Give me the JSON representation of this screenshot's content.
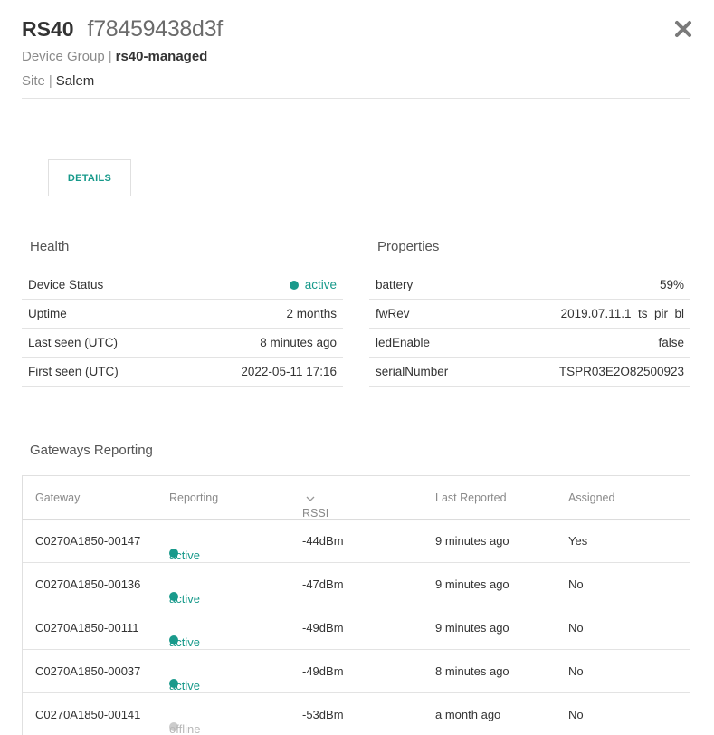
{
  "header": {
    "model": "RS40",
    "device_id": "f78459438d3f",
    "device_group_label": "Device Group",
    "device_group_value": "rs40-managed",
    "site_label": "Site",
    "site_value": "Salem",
    "separator": "|",
    "close_icon": "close-icon"
  },
  "tabs": [
    {
      "label": "DETAILS",
      "selected": true
    }
  ],
  "health": {
    "title": "Health",
    "rows": [
      {
        "label": "Device Status",
        "value": "active",
        "status": "active"
      },
      {
        "label": "Uptime",
        "value": "2 months"
      },
      {
        "label": "Last seen (UTC)",
        "value": "8 minutes ago"
      },
      {
        "label": "First seen (UTC)",
        "value": "2022-05-11 17:16"
      }
    ]
  },
  "properties": {
    "title": "Properties",
    "rows": [
      {
        "label": "battery",
        "value": "59%"
      },
      {
        "label": "fwRev",
        "value": "2019.07.11.1_ts_pir_bl"
      },
      {
        "label": "ledEnable",
        "value": "false"
      },
      {
        "label": "serialNumber",
        "value": "TSPR03E2O82500923"
      }
    ]
  },
  "gateways": {
    "title": "Gateways Reporting",
    "columns": [
      "Gateway",
      "Reporting",
      "RSSI",
      "Last Reported",
      "Assigned"
    ],
    "sort_column": "RSSI",
    "rows": [
      {
        "gateway": "C0270A1850-00147",
        "reporting": "active",
        "rssi": "-44dBm",
        "last_reported": "9 minutes ago",
        "assigned": "Yes"
      },
      {
        "gateway": "C0270A1850-00136",
        "reporting": "active",
        "rssi": "-47dBm",
        "last_reported": "9 minutes ago",
        "assigned": "No"
      },
      {
        "gateway": "C0270A1850-00111",
        "reporting": "active",
        "rssi": "-49dBm",
        "last_reported": "9 minutes ago",
        "assigned": "No"
      },
      {
        "gateway": "C0270A1850-00037",
        "reporting": "active",
        "rssi": "-49dBm",
        "last_reported": "8 minutes ago",
        "assigned": "No"
      },
      {
        "gateway": "C0270A1850-00141",
        "reporting": "offline",
        "rssi": "-53dBm",
        "last_reported": "a month ago",
        "assigned": "No"
      }
    ]
  },
  "colors": {
    "accent": "#16998a",
    "active_dot": "#1a9a8c",
    "offline_dot": "#cccccc"
  }
}
